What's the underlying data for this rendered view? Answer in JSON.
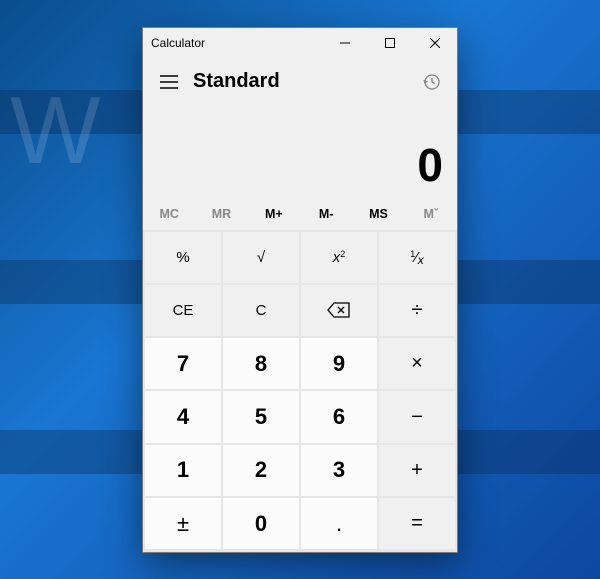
{
  "window": {
    "title": "Calculator"
  },
  "header": {
    "mode": "Standard"
  },
  "display": {
    "value": "0"
  },
  "memory": {
    "mc": {
      "label": "MC",
      "enabled": false
    },
    "mr": {
      "label": "MR",
      "enabled": false
    },
    "mplus": {
      "label": "M+",
      "enabled": true
    },
    "mminus": {
      "label": "M-",
      "enabled": true
    },
    "ms": {
      "label": "MS",
      "enabled": true
    },
    "mlist": {
      "label": "Mˇ",
      "enabled": false
    }
  },
  "keys": {
    "percent": "%",
    "sqrt": "√",
    "square_base": "x",
    "square_exp": "2",
    "reciprocal_num": "1",
    "reciprocal_slash": "⁄",
    "reciprocal_den": "x",
    "ce": "CE",
    "c": "C",
    "divide": "÷",
    "n7": "7",
    "n8": "8",
    "n9": "9",
    "multiply": "×",
    "n4": "4",
    "n5": "5",
    "n6": "6",
    "minus": "−",
    "n1": "1",
    "n2": "2",
    "n3": "3",
    "plus": "+",
    "negate": "±",
    "n0": "0",
    "decimal": ".",
    "equals": "="
  }
}
